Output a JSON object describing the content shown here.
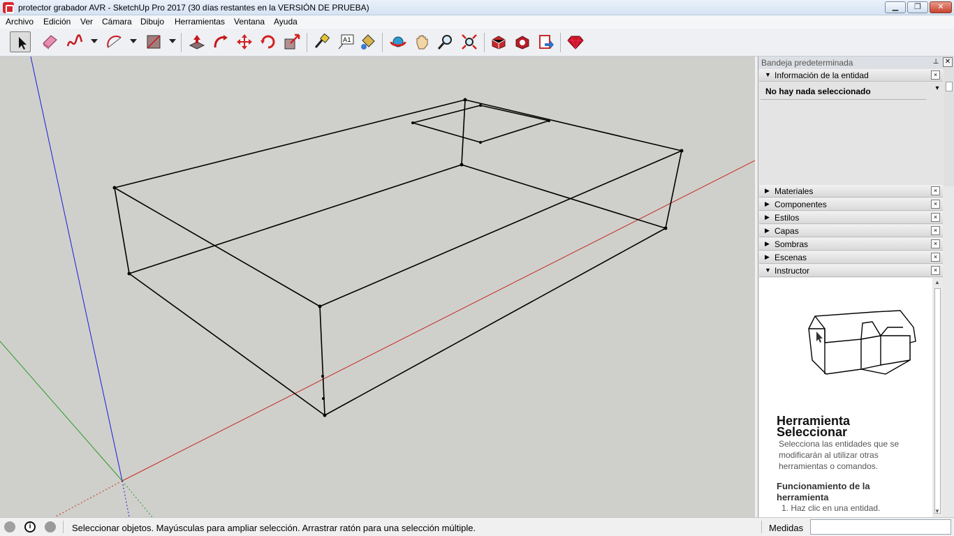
{
  "window": {
    "title": "protector grabador AVR - SketchUp Pro 2017 (30 días restantes en la VERSIÓN DE PRUEBA)",
    "minimize": "▁",
    "maximize": "❐",
    "close": "✕"
  },
  "menu": [
    "Archivo",
    "Edición",
    "Ver",
    "Cámara",
    "Dibujo",
    "Herramientas",
    "Ventana",
    "Ayuda"
  ],
  "toolbar": {
    "tools": [
      "select-icon",
      "eraser-icon",
      "freehand-icon",
      "arc-icon",
      "rectangle-icon",
      "push-pull-icon",
      "follow-me-icon",
      "move-icon",
      "rotate-icon",
      "scale-icon",
      "tape-measure-icon",
      "text-icon",
      "paint-bucket-icon",
      "orbit-icon",
      "pan-icon",
      "zoom-icon",
      "zoom-extents-icon",
      "3d-warehouse-icon",
      "extension-warehouse-icon",
      "layout-send-icon",
      "ruby-console-icon"
    ],
    "text_tool_label": "A1"
  },
  "tray": {
    "title": "Bandeja predeterminada",
    "pin": "⊥",
    "close": "✕",
    "entity_panel": {
      "label": "Información de la entidad",
      "content": "No hay nada seleccionado",
      "toggle": "▾"
    },
    "panels": [
      "Materiales",
      "Componentes",
      "Estilos",
      "Capas",
      "Sombras",
      "Escenas"
    ],
    "instructor": {
      "label": "Instructor",
      "title": "Herramienta Seleccionar",
      "description": "Selecciona las entidades que se modificarán al utilizar otras herramientas o comandos.",
      "subtitle": "Funcionamiento de la herramienta",
      "step": "1. Haz clic en una entidad."
    },
    "expanded_symbol": "▼",
    "collapsed_symbol": "▶",
    "panel_close": "×"
  },
  "statusbar": {
    "info_icon": "i",
    "message": "Seleccionar objetos. Mayúsculas para ampliar selección. Arrastrar ratón para una selección múltiple.",
    "measure_label": "Medidas",
    "measure_value": ""
  },
  "colors": {
    "viewport_bg": "#cfd0cb",
    "axis_red": "#c8281e",
    "axis_green": "#2a9b2a",
    "axis_blue": "#1b1bd6",
    "edges": "#000000"
  }
}
